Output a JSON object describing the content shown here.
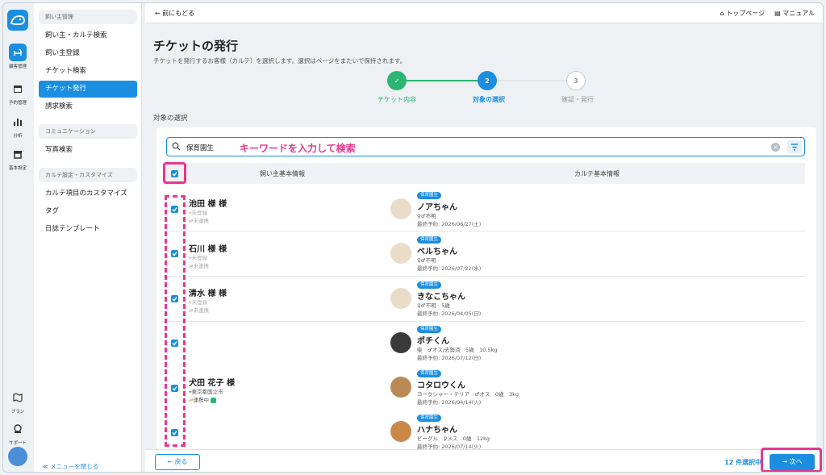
{
  "colors": {
    "accent": "#1b8ee0",
    "highlight": "#e8378f",
    "success": "#2bb673"
  },
  "rail": {
    "items": [
      {
        "label": "顧客管理",
        "icon": "dog-icon"
      },
      {
        "label": "予約管理",
        "icon": "calendar-icon"
      },
      {
        "label": "分析",
        "icon": "chart-icon"
      },
      {
        "label": "基本設定",
        "icon": "store-icon"
      },
      {
        "label": "プラン",
        "icon": "map-icon"
      },
      {
        "label": "サポート",
        "icon": "support-icon"
      }
    ]
  },
  "menu": {
    "groups": [
      "飼い主管理",
      "コミュニケーション",
      "カルテ設定・カスタマイズ"
    ],
    "items": [
      "飼い主・カルテ検索",
      "飼い主登録",
      "チケット検索",
      "チケット発行",
      "請求検索",
      "写真検索",
      "カルテ項目のカスタマイズ",
      "タグ",
      "日誌テンプレート"
    ],
    "close": "≪ メニューを閉じる"
  },
  "topbar": {
    "back": "前にもどる",
    "home": "トップページ",
    "manual": "マニュアル"
  },
  "page": {
    "title": "チケットの発行",
    "description": "チケットを発行するお客様（カルテ）を選択します。選択はページをまたいで保持されます。",
    "section": "対象の選択"
  },
  "steps": [
    {
      "num": "✓",
      "label": "チケット内容"
    },
    {
      "num": "2",
      "label": "対象の選択"
    },
    {
      "num": "3",
      "label": "確認・発行"
    }
  ],
  "search": {
    "value": "保育園生",
    "hint": "キーワードを入力して検索"
  },
  "table": {
    "col_owner": "飼い主基本情報",
    "col_karte": "カルテ基本情報",
    "owners": [
      {
        "name": "池田 様 様",
        "line1": "未登録",
        "line2": "未連携"
      },
      {
        "name": "石川 様 様",
        "line1": "未登録",
        "line2": "未連携"
      },
      {
        "name": "清水 様 様",
        "line1": "未登録",
        "line2": "未連携"
      },
      {
        "name": "犬田 花子 様",
        "line1": "東京都国立市",
        "line2": "連携中"
      }
    ],
    "pets": [
      {
        "tag": "保育園生",
        "name": "ノアちゃん",
        "info": "♀♂不明",
        "last": "最終予約: 2026/06/27(土)"
      },
      {
        "tag": "保育園生",
        "name": "ベルちゃん",
        "info": "♀♂不明",
        "last": "最終予約: 2026/07/22(水)"
      },
      {
        "tag": "保育園生",
        "name": "きなこちゃん",
        "info": "♀♂不明　5歳",
        "last": "最終予約: 2026/04/05(日)"
      },
      {
        "tag": "保育園生",
        "name": "ポチくん",
        "info": "柴　♂オス/去勢済　5歳　10.5kg",
        "last": "最終予約: 2026/07/12(日)"
      },
      {
        "tag": "保育園生",
        "name": "コタロウくん",
        "info": "ヨークシャー・テリア　♂オス　0歳　3kg",
        "last": "最終予約: 2026/04/14(火)"
      },
      {
        "tag": "保育園生",
        "name": "ハナちゃん",
        "info": "ビーグル　♀メス　0歳　12kg",
        "last": "最終予約: 2026/07/14(火)"
      }
    ]
  },
  "footer": {
    "prev": "← 戻る",
    "count": "12 件選択中",
    "next": "→ 次へ"
  }
}
